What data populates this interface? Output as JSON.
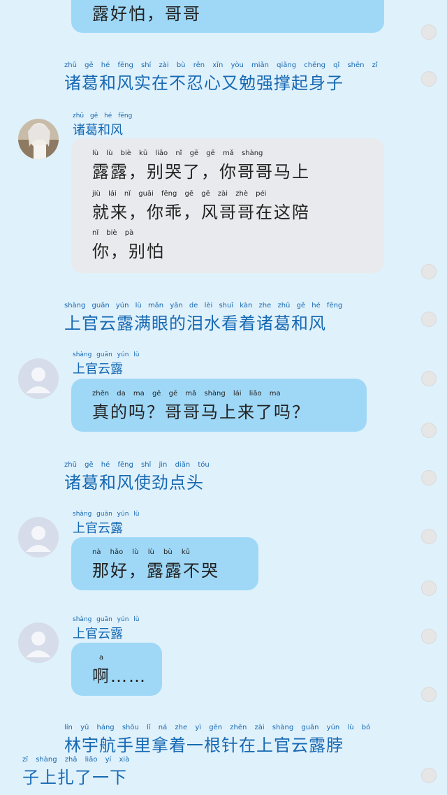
{
  "bubble_top": {
    "text": "露好怕，哥哥"
  },
  "narration_1": {
    "pinyin": "zhū gě hé fēng shí zài bù rěn xīn yòu miǎn qiǎng chēng qǐ shēn zǐ",
    "text": "诸葛和风实在不忍心又勉强撑起身子"
  },
  "msg_zhuge": {
    "name_pinyin": "zhū gě hé fēng",
    "name": "诸葛和风",
    "lines": [
      {
        "pinyin": "lù lù biè kū liǎo nǐ gē gē mǎ shàng",
        "text": "露露，别哭了，你哥哥马上"
      },
      {
        "pinyin": "jiù lái nǐ guāi fēng gē gē zài zhè péi",
        "text": "就来，你乖，风哥哥在这陪"
      },
      {
        "pinyin": "nǐ biè pà",
        "text": "你，别怕"
      }
    ]
  },
  "narration_2": {
    "pinyin": "shàng guān yún lù mǎn yǎn de lèi shuǐ kàn zhe zhū gě hé fēng",
    "text": "上官云露满眼的泪水看着诸葛和风"
  },
  "msg_lu_1": {
    "name_pinyin": "shàng guān yún lù",
    "name": "上官云露",
    "pinyin": "zhēn da ma gē gē mǎ shàng lái liǎo ma",
    "text": "真的吗？哥哥马上来了吗？"
  },
  "narration_3": {
    "pinyin": "zhū gě hé fēng shǐ jìn diǎn tóu",
    "text": "诸葛和风使劲点头"
  },
  "msg_lu_2": {
    "name_pinyin": "shàng guān yún lù",
    "name": "上官云露",
    "pinyin": "nà hǎo lù lù bù kū",
    "text": "那好，露露不哭"
  },
  "msg_lu_3": {
    "name_pinyin": "shàng guān yún lù",
    "name": "上官云露",
    "pinyin": "a",
    "text": "啊……"
  },
  "narration_4": {
    "line1_pinyin": "lín yǔ háng shǒu lǐ ná zhe yì gēn zhēn zài shàng guān yún lù bó",
    "line1": "林宇航手里拿着一根针在上官云露脖",
    "line2_pinyin": "zǐ shàng zhā liǎo yí xià",
    "line2": "子上扎了一下"
  }
}
